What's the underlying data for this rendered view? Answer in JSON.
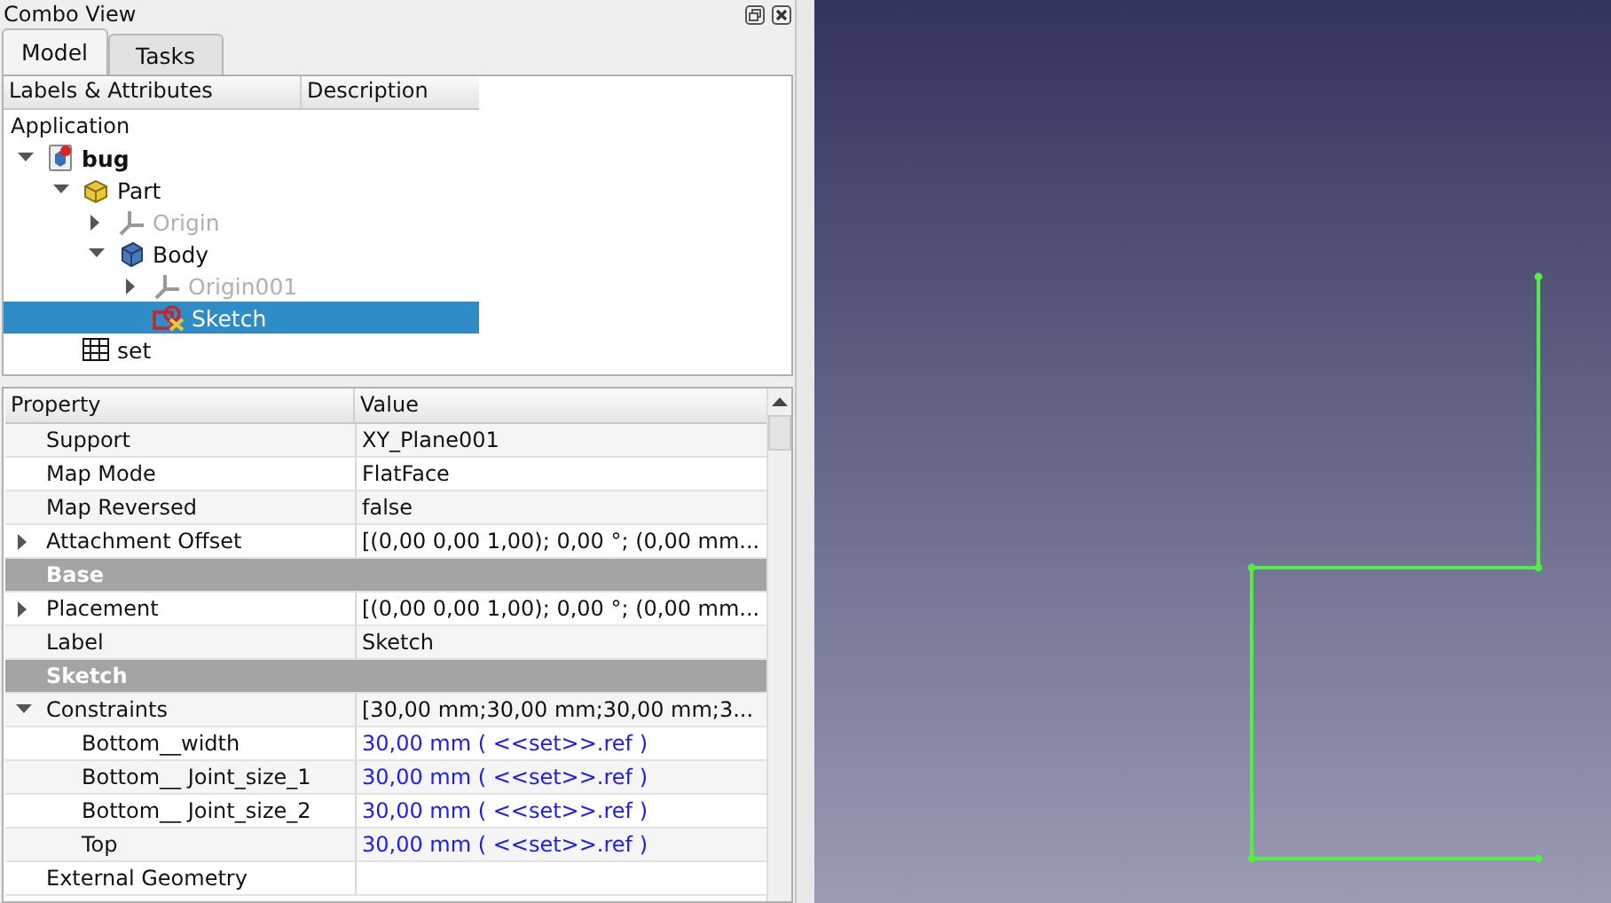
{
  "combo_view": {
    "title": "Combo View",
    "tabs": [
      {
        "label": "Model",
        "selected": true
      },
      {
        "label": "Tasks",
        "selected": false
      }
    ],
    "tree": {
      "columns": [
        "Labels & Attributes",
        "Description"
      ],
      "root_label": "Application",
      "items": [
        {
          "label": "bug",
          "kind": "document",
          "bold": true,
          "expanded": true,
          "selected": false,
          "dimmed": false,
          "children": [
            {
              "label": "Part",
              "kind": "part",
              "expanded": true,
              "selected": false,
              "dimmed": false,
              "children": [
                {
                  "label": "Origin",
                  "kind": "origin",
                  "expanded": false,
                  "selected": false,
                  "dimmed": true
                },
                {
                  "label": "Body",
                  "kind": "body",
                  "expanded": true,
                  "selected": false,
                  "dimmed": false,
                  "children": [
                    {
                      "label": "Origin001",
                      "kind": "origin",
                      "expanded": false,
                      "selected": false,
                      "dimmed": true
                    },
                    {
                      "label": "Sketch",
                      "kind": "sketch",
                      "selected": true,
                      "dimmed": false
                    }
                  ]
                }
              ]
            },
            {
              "label": "set",
              "kind": "spreadsheet",
              "selected": false,
              "dimmed": false
            }
          ]
        }
      ]
    },
    "properties": {
      "columns": [
        "Property",
        "Value"
      ],
      "rows": [
        {
          "kind": "property",
          "name": "Support",
          "value": "XY_Plane001"
        },
        {
          "kind": "property",
          "name": "Map Mode",
          "value": "FlatFace"
        },
        {
          "kind": "property",
          "name": "Map Reversed",
          "value": "false"
        },
        {
          "kind": "property",
          "name": "Attachment Offset",
          "value": "[(0,00 0,00 1,00); 0,00 °; (0,00 mm...",
          "expanded": false
        },
        {
          "kind": "group",
          "name": "Base"
        },
        {
          "kind": "property",
          "name": "Placement",
          "value": "[(0,00 0,00 1,00); 0,00 °; (0,00 mm...",
          "expanded": false
        },
        {
          "kind": "property",
          "name": "Label",
          "value": "Sketch"
        },
        {
          "kind": "group",
          "name": "Sketch"
        },
        {
          "kind": "property",
          "name": "Constraints",
          "value": "[30,00 mm;30,00 mm;30,00 mm;3...",
          "expanded": true,
          "children": [
            {
              "kind": "expression",
              "name": "Bottom__width",
              "value": "30,00 mm  ( <<set>>.ref )"
            },
            {
              "kind": "expression",
              "name": "Bottom__ Joint_size_1",
              "value": "30,00 mm  ( <<set>>.ref )"
            },
            {
              "kind": "expression",
              "name": "Bottom__ Joint_size_2",
              "value": "30,00 mm  ( <<set>>.ref )"
            },
            {
              "kind": "expression",
              "name": "Top",
              "value": "30,00 mm  ( <<set>>.ref )"
            }
          ]
        },
        {
          "kind": "property",
          "name": "External Geometry",
          "value": ""
        }
      ]
    }
  }
}
